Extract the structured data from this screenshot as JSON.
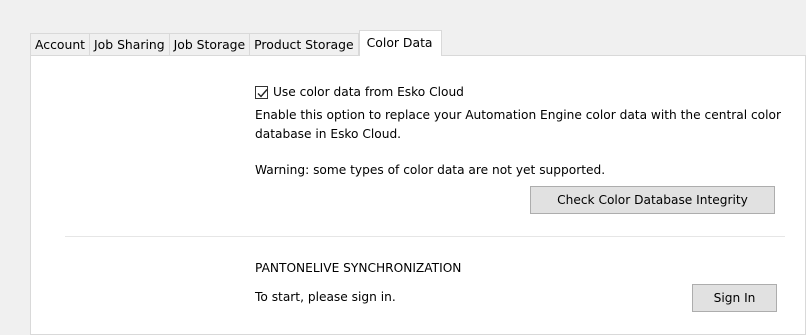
{
  "tabs": [
    {
      "label": "Account"
    },
    {
      "label": "Job Sharing"
    },
    {
      "label": "Job Storage"
    },
    {
      "label": "Product Storage"
    },
    {
      "label": "Color Data",
      "active": true
    }
  ],
  "color_data": {
    "checkbox_label": "Use color data from Esko Cloud",
    "checkbox_checked": true,
    "description": "Enable this option to replace your Automation Engine color data with the central color database in Esko Cloud.",
    "warning": "Warning: some types of color data are not yet supported.",
    "integrity_button_label": "Check Color Database Integrity"
  },
  "pantonelive": {
    "heading": "PANTONELIVE SYNCHRONIZATION",
    "status": "To start, please sign in.",
    "sign_in_label": "Sign In"
  }
}
